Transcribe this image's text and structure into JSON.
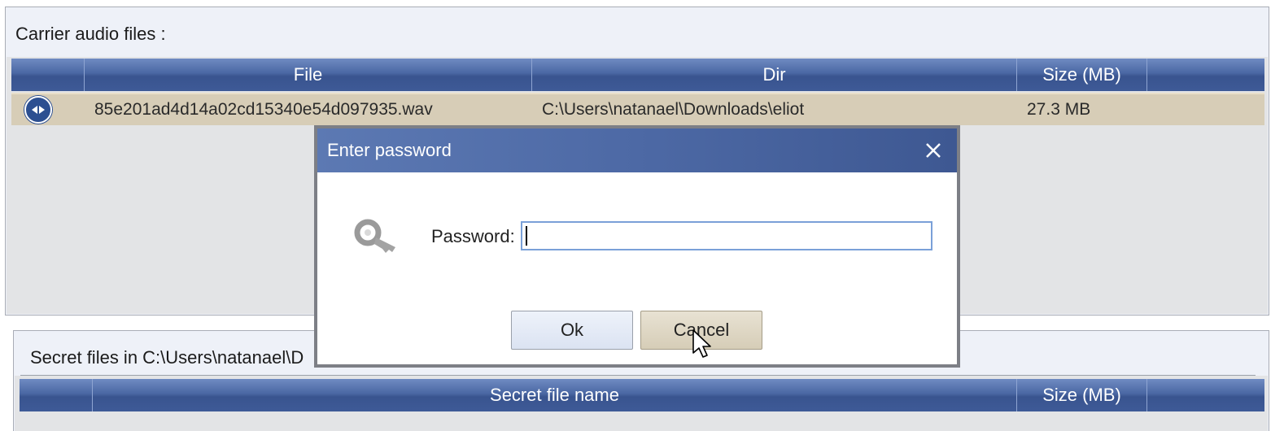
{
  "carrier_panel": {
    "title": "Carrier audio files :",
    "columns": [
      "File",
      "Dir",
      "Size (MB)",
      ""
    ],
    "rows": [
      {
        "file": "85e201ad4d14a02cd15340e54d097935.wav",
        "dir": "C:\\Users\\natanael\\Downloads\\eliot",
        "size": "27.3 MB",
        "icon": "audio-file-icon"
      }
    ]
  },
  "secret_panel": {
    "title": "Secret files in C:\\Users\\natanael\\D",
    "columns": [
      "",
      "Secret file name",
      "Size (MB)",
      ""
    ]
  },
  "dialog": {
    "title": "Enter password",
    "password_label": "Password:",
    "password_value": "",
    "ok_label": "Ok",
    "cancel_label": "Cancel",
    "icon": "key-icon",
    "close_icon": "close-icon"
  },
  "colors": {
    "header_blue": "#3e5a97",
    "selected_row": "#d7cdb7",
    "dialog_title": "#4d69a5",
    "input_border": "#7aa0d8"
  }
}
